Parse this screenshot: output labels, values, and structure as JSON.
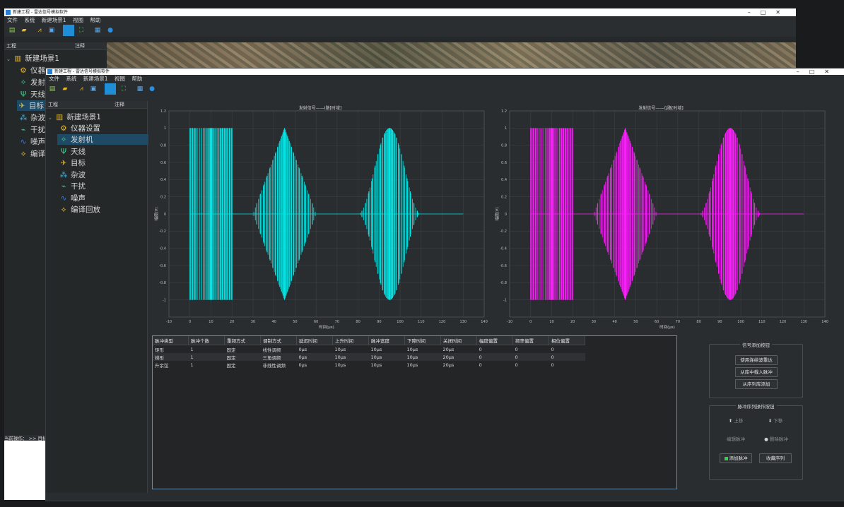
{
  "app": {
    "title": "新建工程 - 雷达信号模拟软件",
    "window_controls": [
      "–",
      "□",
      "✕"
    ]
  },
  "menu": [
    "文件",
    "系统",
    "新建场景1",
    "视图",
    "帮助"
  ],
  "toolbar_icons": [
    "new-file-icon",
    "open-folder-icon",
    "signal-wave-icon",
    "export-icon",
    "select-arrow-icon",
    "fullscreen-icon",
    "save-icon",
    "info-icon"
  ],
  "back_panel": {
    "col_project": "工程",
    "col_note": "注释",
    "root": "新建场景1",
    "items": [
      "仪器",
      "发射",
      "天线",
      "目标",
      "杂波",
      "干扰",
      "噪声",
      "编译"
    ],
    "status": "当前操作：  >> 目标"
  },
  "panel": {
    "col_project": "工程",
    "col_note": "注释",
    "root": "新建场景1",
    "items": [
      "仪器设置",
      "发射机",
      "天线",
      "目标",
      "杂波",
      "干扰",
      "噪声",
      "编译回放"
    ],
    "selected": "发射机"
  },
  "colors": {
    "accent": "#1e8fd6",
    "i_series": "#00e5e5",
    "q_series": "#ff1cff",
    "selected_row": "#1f4a66"
  },
  "chart_data": [
    {
      "type": "line",
      "title": "发射信号——I路[时域]",
      "xlabel": "时间(μs)",
      "ylabel": "幅度(V)",
      "xlim": [
        -10,
        140
      ],
      "ylim": [
        -1.2,
        1.2
      ],
      "xticks": [
        -10,
        0,
        10,
        20,
        30,
        40,
        50,
        60,
        70,
        80,
        90,
        100,
        110,
        120,
        130,
        140
      ],
      "yticks": [
        1.2,
        1,
        0.8,
        0.6,
        0.4,
        0.2,
        0,
        -0.2,
        -0.4,
        -0.6,
        -0.8,
        -1
      ],
      "grid": true,
      "series": [
        {
          "color": "#00e5e5",
          "segments": [
            {
              "shape": "rect",
              "x0": 0,
              "x1": 20,
              "amp": 1
            },
            {
              "shape": "triangle",
              "x0": 30,
              "x1": 60,
              "amp": 1
            },
            {
              "shape": "raised-cosine",
              "x0": 80,
              "x1": 110,
              "amp": 1
            }
          ],
          "x_end": 130
        }
      ]
    },
    {
      "type": "line",
      "title": "发射信号——Q路[时域]",
      "xlabel": "时间(μs)",
      "ylabel": "幅度(V)",
      "xlim": [
        -10,
        140
      ],
      "ylim": [
        -1.2,
        1.2
      ],
      "xticks": [
        -10,
        0,
        10,
        20,
        30,
        40,
        50,
        60,
        70,
        80,
        90,
        100,
        110,
        120,
        130,
        140
      ],
      "yticks": [
        1.2,
        1,
        0.8,
        0.6,
        0.4,
        0.2,
        0,
        -0.2,
        -0.4,
        -0.6,
        -0.8,
        -1
      ],
      "grid": true,
      "series": [
        {
          "color": "#ff1cff",
          "segments": [
            {
              "shape": "rect",
              "x0": 0,
              "x1": 20,
              "amp": 1
            },
            {
              "shape": "triangle",
              "x0": 30,
              "x1": 60,
              "amp": 1
            },
            {
              "shape": "raised-cosine",
              "x0": 80,
              "x1": 110,
              "amp": 1
            }
          ],
          "x_end": 130
        }
      ]
    }
  ],
  "pulse_table": {
    "headers": [
      "脉冲类型",
      "脉冲个数",
      "重频方式",
      "调制方式",
      "延迟时间",
      "上升时间",
      "脉冲宽度",
      "下降时间",
      "关闭时间",
      "幅度偏置",
      "频率偏置",
      "相位偏置"
    ],
    "rows": [
      [
        "矩形",
        "1",
        "固定",
        "线性调频",
        "0μs",
        "10μs",
        "10μs",
        "10μs",
        "20μs",
        "0",
        "0",
        "0"
      ],
      [
        "梯形",
        "1",
        "固定",
        "三角调频",
        "0μs",
        "10μs",
        "10μs",
        "10μs",
        "20μs",
        "0",
        "0",
        "0"
      ],
      [
        "升余弦",
        "1",
        "固定",
        "非线性调频",
        "0μs",
        "10μs",
        "10μs",
        "10μs",
        "20μs",
        "0",
        "0",
        "0"
      ]
    ]
  },
  "signal_group": {
    "title": "信号添加按钮",
    "buttons": [
      "使用连续波重达",
      "从库中载入脉冲",
      "从序列库添加"
    ]
  },
  "sequence_group": {
    "title": "脉冲序列操作按钮",
    "up": "上移",
    "down": "下移",
    "edit": "编辑脉冲",
    "delete": "删除脉冲",
    "add": "添加脉冲",
    "save": "收藏序列"
  }
}
